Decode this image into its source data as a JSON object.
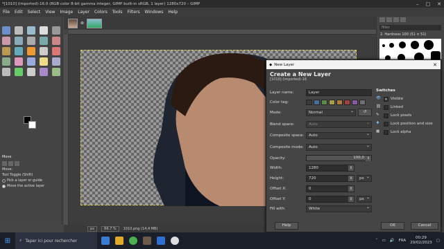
{
  "window": {
    "title": "*[1010] (imported)-16.0 (RGB color 8-bit gamma integer, GIMP built-in sRGB, 1 layer) 1280x720 – GIMP"
  },
  "menu": [
    "File",
    "Edit",
    "Select",
    "View",
    "Image",
    "Layer",
    "Colors",
    "Tools",
    "Filters",
    "Windows",
    "Help"
  ],
  "tool_options": {
    "title": "Move",
    "move_label": "Move:",
    "toggle_label": "Tool Toggle  (Shift)",
    "option1": "Pick a layer or guide",
    "option2": "Move the active layer"
  },
  "status": {
    "unit": "px",
    "zoom": "66.7 %",
    "file": "1010.png (14,4 MB)"
  },
  "brushes": {
    "filter_placeholder": "filter",
    "name": "2. Hardness 100 (51 × 51)"
  },
  "dialog": {
    "title": "New Layer",
    "heading": "Create a New Layer",
    "subheading": "[1010] (imported)-16",
    "labels": {
      "layer_name": "Layer name:",
      "color_tag": "Color tag:",
      "mode": "Mode:",
      "blend_space": "Blend space:",
      "composite_space": "Composite space:",
      "composite_mode": "Composite mode:",
      "opacity": "Opacity:",
      "width": "Width:",
      "height": "Height:",
      "offset_x": "Offset X:",
      "offset_y": "Offset Y:",
      "fill_with": "Fill with:"
    },
    "values": {
      "layer_name": "Layer",
      "mode": "Normal",
      "blend_space": "Auto",
      "composite_space": "Auto",
      "composite_mode": "Auto",
      "opacity": "100,0",
      "width": "1280",
      "height": "720",
      "size_unit": "px",
      "offset_x": "0",
      "offset_y": "0",
      "offset_unit": "px",
      "fill_with": "White"
    },
    "switches": {
      "heading": "Switches",
      "visible": "Visible",
      "linked": "Linked",
      "lock_pixels": "Lock pixels",
      "lock_position": "Lock position and size",
      "lock_alpha": "Lock alpha"
    },
    "buttons": {
      "help": "Help",
      "ok": "OK",
      "cancel": "Cancel"
    },
    "colors": {
      "tags": [
        "#4b6d99",
        "#5c8a4a",
        "#a6a04a",
        "#b07a3a",
        "#a64040",
        "#8a5aa0",
        "#707070"
      ]
    }
  },
  "taskbar": {
    "search_placeholder": "Taper ici pour rechercher",
    "lang": "FRA",
    "time": "00:29",
    "date": "20/02/2023"
  }
}
